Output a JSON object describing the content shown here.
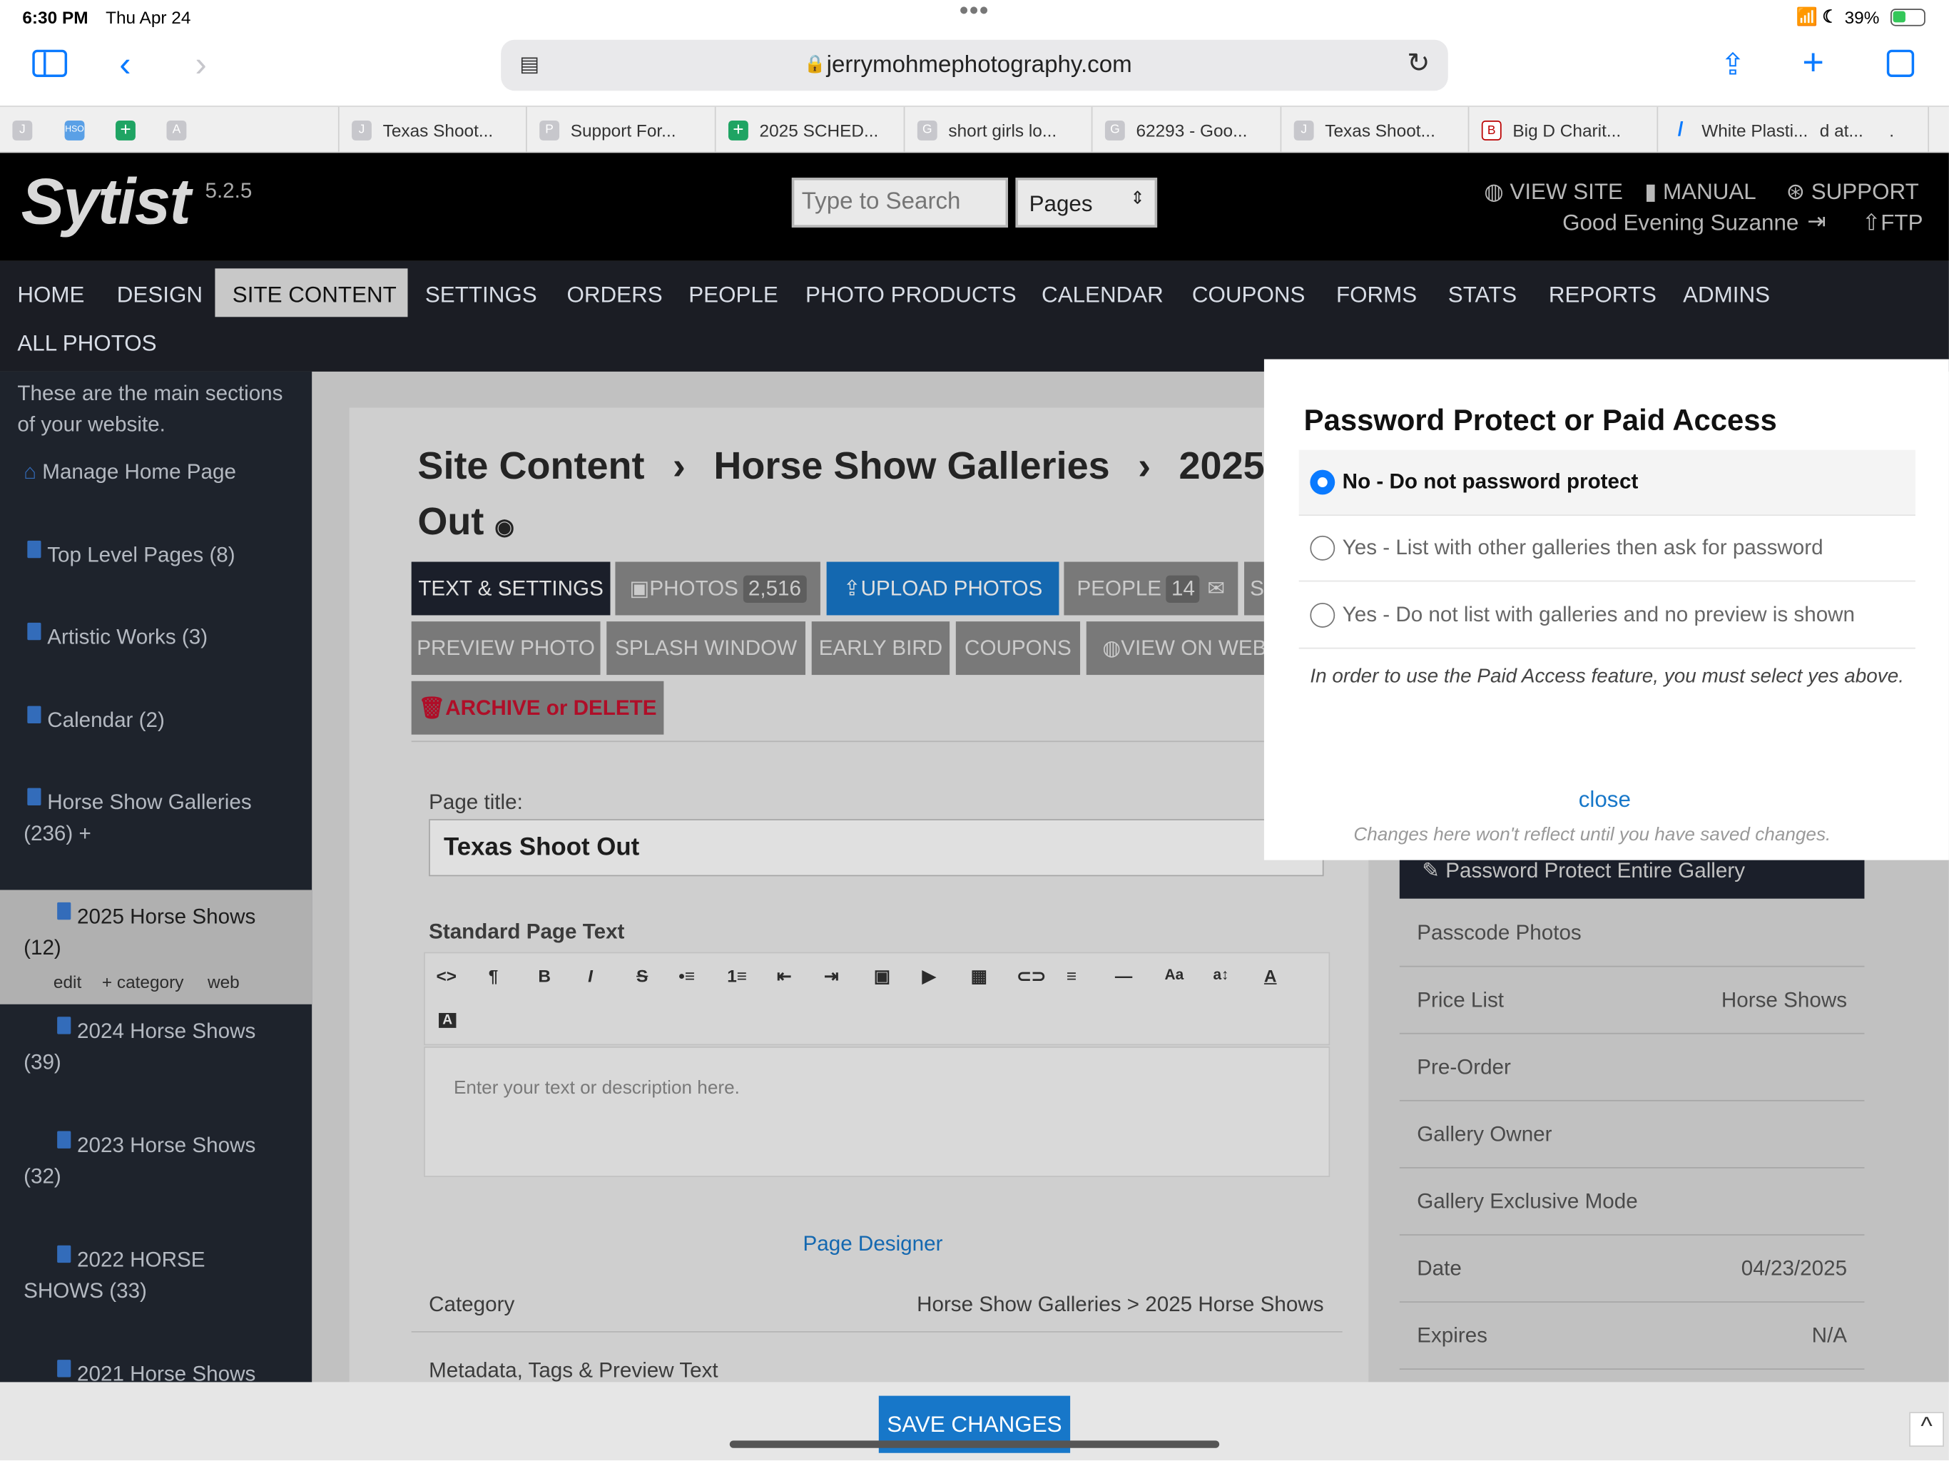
{
  "status": {
    "time": "6:30 PM",
    "date": "Thu Apr 24",
    "battery": "39%"
  },
  "browser": {
    "url": "jerrymohmephotography.com",
    "tabs": [
      {
        "icon": "J",
        "title": ""
      },
      {
        "icon": "HSO",
        "title": ""
      },
      {
        "icon": "+",
        "title": ""
      },
      {
        "icon": "A",
        "title": ""
      },
      {
        "icon": "J",
        "title": "Texas Shoot..."
      },
      {
        "icon": "P",
        "title": "Support For..."
      },
      {
        "icon": "+",
        "title": "2025 SCHED..."
      },
      {
        "icon": "G",
        "title": "short girls lo..."
      },
      {
        "icon": "G",
        "title": "62293 - Goo..."
      },
      {
        "icon": "J",
        "title": "Texas Shoot..."
      },
      {
        "icon": "B",
        "title": "Big D Charit..."
      },
      {
        "icon": "/",
        "title": "White Plasti..."
      },
      {
        "icon": "",
        "title": "d at..."
      },
      {
        "icon": "",
        "title": "."
      }
    ]
  },
  "app": {
    "logo": "Sytist",
    "version": "5.2.5",
    "search_placeholder": "Type to Search",
    "search_scope": "Pages",
    "links": [
      "VIEW SITE",
      "MANUAL",
      "SUPPORT"
    ],
    "greeting": "Good Evening Suzanne",
    "ftp": "FTP",
    "nav": [
      "HOME",
      "DESIGN",
      "SITE CONTENT",
      "SETTINGS",
      "ORDERS",
      "PEOPLE",
      "PHOTO PRODUCTS",
      "CALENDAR",
      "COUPONS",
      "FORMS",
      "STATS",
      "REPORTS",
      "ADMINS",
      "ALL PHOTOS"
    ],
    "active_nav": "SITE CONTENT"
  },
  "sidebar": {
    "intro": [
      "These are the main sections",
      "of your website."
    ],
    "items": [
      {
        "label": "Manage Home Page"
      },
      {
        "label": "Top Level Pages (8)"
      },
      {
        "label": "Artistic Works (3)"
      },
      {
        "label": "Calendar (2)"
      },
      {
        "label": "Horse Show Galleries",
        "label2": "(236) +"
      },
      {
        "label": "2025 Horse Shows",
        "label2": "(12)"
      },
      {
        "label": "2024 Horse Shows",
        "label2": "(39)"
      },
      {
        "label": "2023 Horse Shows",
        "label2": "(32)"
      },
      {
        "label": "2022 HORSE",
        "label2": "SHOWS (33)"
      },
      {
        "label": "2021 Horse Shows"
      }
    ],
    "sub_actions": [
      "edit",
      "+ category",
      "web"
    ]
  },
  "page": {
    "breadcrumb": [
      "Site Content",
      "Horse Show Galleries",
      "2025"
    ],
    "title_line2": "Out",
    "buttons_row1": [
      {
        "label": "TEXT & SETTINGS"
      },
      {
        "label": "PHOTOS",
        "count": "2,516"
      },
      {
        "label": "UPLOAD PHOTOS"
      },
      {
        "label": "PEOPLE",
        "count": "14"
      },
      {
        "label": "S"
      }
    ],
    "buttons_row2": [
      "PREVIEW PHOTO",
      "SPLASH WINDOW",
      "EARLY BIRD",
      "COUPONS",
      "VIEW ON WEB"
    ],
    "archive_button": "ARCHIVE or DELETE",
    "page_title_label": "Page title:",
    "page_title_value": "Texas Shoot Out",
    "standard_text_label": "Standard Page Text",
    "editor_placeholder": "Enter your text or description here.",
    "editor_tools": [
      "<>",
      "¶",
      "B",
      "I",
      "S",
      "•≡",
      "1≡",
      "⇤",
      "⇥",
      "▣",
      "▶",
      "▦",
      "⊂⊃",
      "≡",
      "—",
      "Aa",
      "a↕",
      "A",
      "A"
    ],
    "page_designer": "Page Designer",
    "category_label": "Category",
    "category_value": "Horse Show Galleries > 2025 Horse Shows",
    "metadata_label": "Metadata, Tags & Preview Text"
  },
  "right_panel": {
    "protect_button": "Password Protect Entire Gallery",
    "rows": [
      {
        "key": "Passcode Photos",
        "value": ""
      },
      {
        "key": "Price List",
        "value": "Horse Shows"
      },
      {
        "key": "Pre-Order",
        "value": ""
      },
      {
        "key": "Gallery Owner",
        "value": ""
      },
      {
        "key": "Gallery Exclusive Mode",
        "value": ""
      },
      {
        "key": "Date",
        "value": "04/23/2025"
      },
      {
        "key": "Expires",
        "value": "N/A"
      }
    ]
  },
  "modal": {
    "title": "Password Protect or Paid Access",
    "options": [
      {
        "label": "No - Do not password protect",
        "selected": true
      },
      {
        "label": "Yes - List with other galleries then ask for password",
        "selected": false
      },
      {
        "label": "Yes - Do not list with galleries and no preview is shown",
        "selected": false
      }
    ],
    "note": "In order to use the Paid Access feature, you must select yes above.",
    "close": "close",
    "footnote": "Changes here won't reflect until you have saved changes."
  },
  "footer": {
    "save": "SAVE CHANGES",
    "scroll_top": "^"
  },
  "colors": {
    "accent": "#0a7aff",
    "upload": "#1777c9",
    "archive_text": "#c8102e",
    "sidebar": "#232833",
    "nav_bg": "#1b1d24"
  }
}
